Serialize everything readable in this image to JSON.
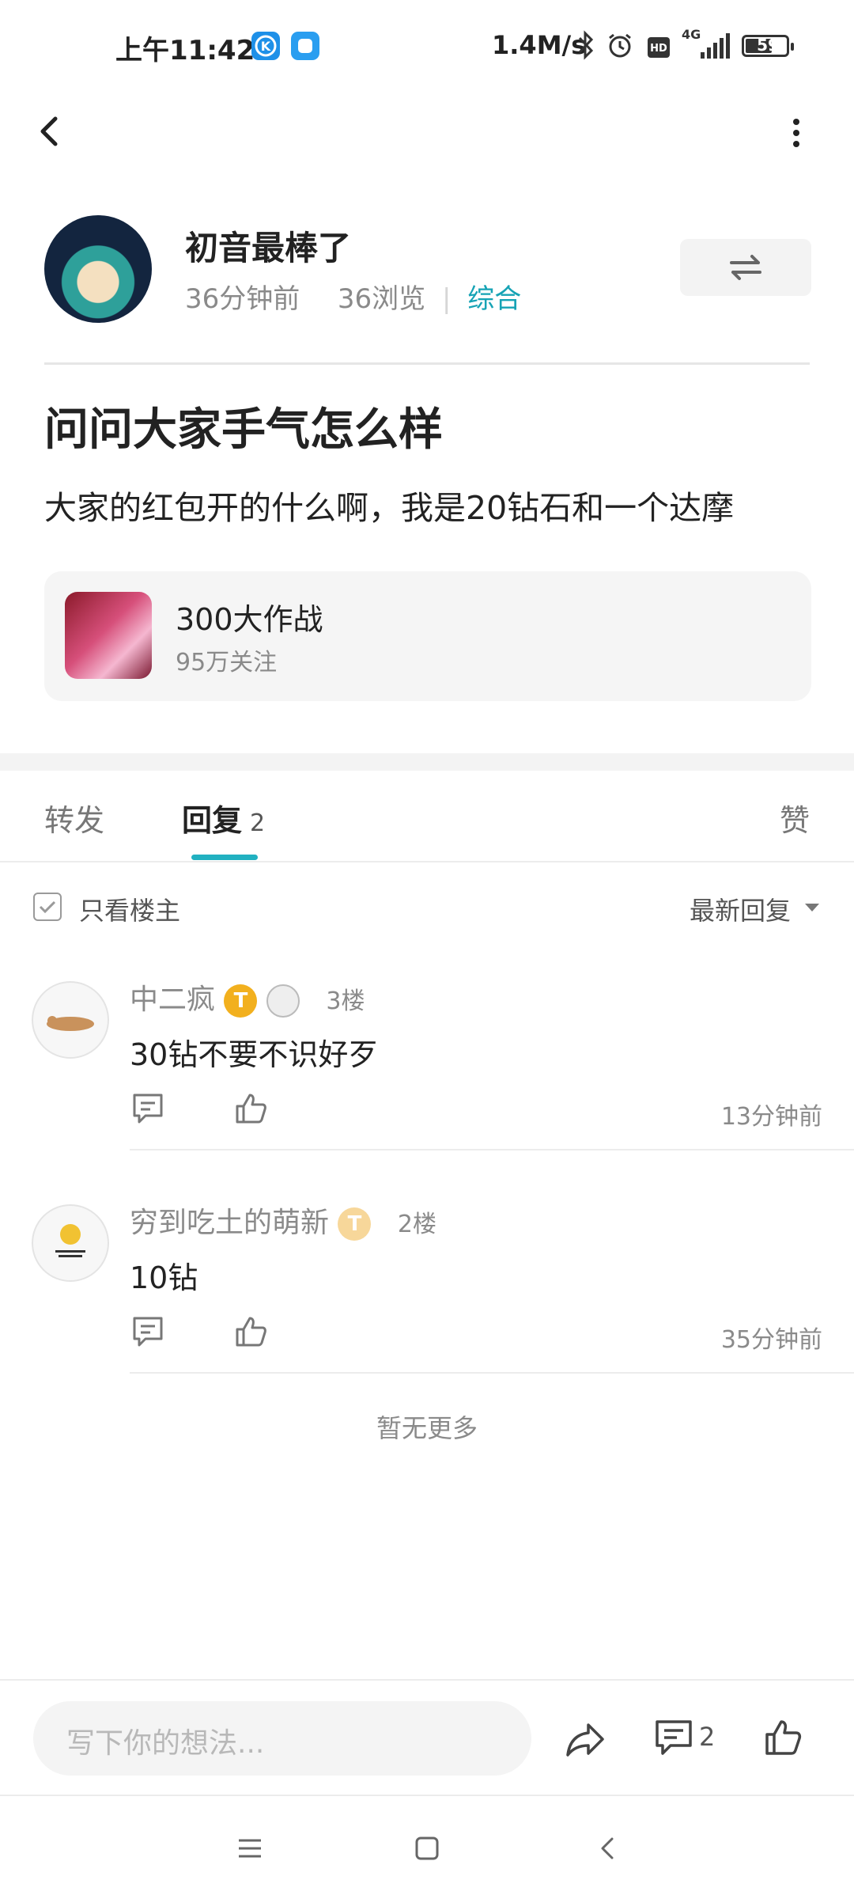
{
  "status_bar": {
    "time": "上午11:42",
    "network_speed": "1.4M/s",
    "signal_label": "4G",
    "battery": "59",
    "icons": [
      "k-app-icon",
      "blue-app-icon",
      "bluetooth-icon",
      "alarm-icon",
      "hd-icon",
      "signal-icon",
      "battery-icon"
    ]
  },
  "nav": {
    "back_icon": "chevron-left-icon",
    "more_icon": "more-vertical-icon"
  },
  "author": {
    "name": "初音最棒了",
    "time_ago": "36分钟前",
    "views": "36浏览",
    "separator": "|",
    "category": "综合"
  },
  "post": {
    "title": "问问大家手气怎么样",
    "body": "大家的红包开的什么啊，我是20钻石和一个达摩"
  },
  "game": {
    "name": "300大作战",
    "followers": "95万关注"
  },
  "tabs": [
    {
      "label": "转发",
      "count": ""
    },
    {
      "label": "回复",
      "count": "2"
    },
    {
      "label": "赞",
      "count": ""
    }
  ],
  "filter": {
    "only_op_label": "只看楼主",
    "sort_label": "最新回复"
  },
  "replies": [
    {
      "user": "中二疯",
      "badge": "T",
      "floor": "3楼",
      "text": "30钻不要不识好歹",
      "time": "13分钟前"
    },
    {
      "user": "穷到吃土的萌新",
      "badge": "T",
      "floor": "2楼",
      "text": "10钻",
      "time": "35分钟前"
    }
  ],
  "no_more": "暂无更多",
  "bottom_bar": {
    "placeholder": "写下你的想法...",
    "comment_count": "2"
  },
  "colors": {
    "accent": "#21b1c1",
    "category": "#16a3b5",
    "badge": "#f2b01e"
  }
}
